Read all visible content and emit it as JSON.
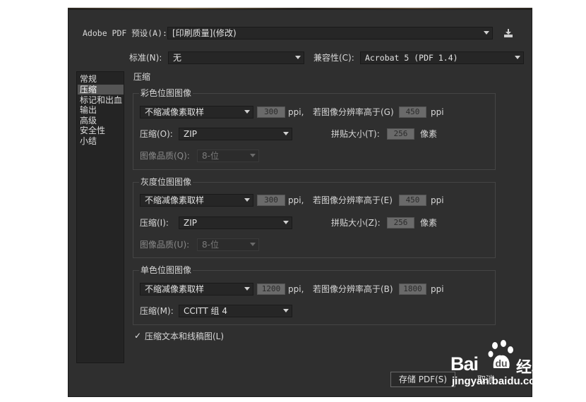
{
  "header": {
    "preset_label": "Adobe PDF 预设(A):",
    "preset_value": "[印刷质量](修改)",
    "standard_label": "标准(N):",
    "standard_value": "无",
    "compat_label": "兼容性(C):",
    "compat_value": "Acrobat 5 (PDF 1.4)"
  },
  "sidebar": {
    "items": [
      {
        "label": "常规"
      },
      {
        "label": "压缩"
      },
      {
        "label": "标记和出血"
      },
      {
        "label": "输出"
      },
      {
        "label": "高级"
      },
      {
        "label": "安全性"
      },
      {
        "label": "小结"
      }
    ],
    "active_index": 1
  },
  "section_title": "压缩",
  "color_group": {
    "title": "彩色位图图像",
    "sampling": "不缩减像素取样",
    "ppi_value": "300",
    "ppi_unit": "ppi,",
    "above_label": "若图像分辨率高于(G)",
    "above_value": "450",
    "above_unit": "ppi",
    "compression_label": "压缩(O):",
    "compression_value": "ZIP",
    "tile_label": "拼贴大小(T):",
    "tile_value": "256",
    "tile_unit": "像素",
    "quality_label": "图像品质(Q):",
    "quality_value": "8-位"
  },
  "gray_group": {
    "title": "灰度位图图像",
    "sampling": "不缩减像素取样",
    "ppi_value": "300",
    "ppi_unit": "ppi,",
    "above_label": "若图像分辨率高于(E)",
    "above_value": "450",
    "above_unit": "ppi",
    "compression_label": "压缩(I):",
    "compression_value": "ZIP",
    "tile_label": "拼贴大小(Z):",
    "tile_value": "256",
    "tile_unit": "像素",
    "quality_label": "图像品质(U):",
    "quality_value": "8-位"
  },
  "mono_group": {
    "title": "单色位图图像",
    "sampling": "不缩减像素取样",
    "ppi_value": "1200",
    "ppi_unit": "ppi,",
    "above_label": "若图像分辨率高于(B)",
    "above_value": "1800",
    "above_unit": "ppi",
    "compression_label": "压缩(M):",
    "compression_value": "CCITT 组 4"
  },
  "compress_text": {
    "checkmark": "✓",
    "label": "压缩文本和线稿图(L)",
    "checked": true
  },
  "buttons": {
    "save": "存储 PDF(S)",
    "cancel": "取消"
  },
  "watermark": {
    "brand_left": "Bai",
    "brand_right": "经验",
    "url": "jingyan.baidu.com"
  }
}
